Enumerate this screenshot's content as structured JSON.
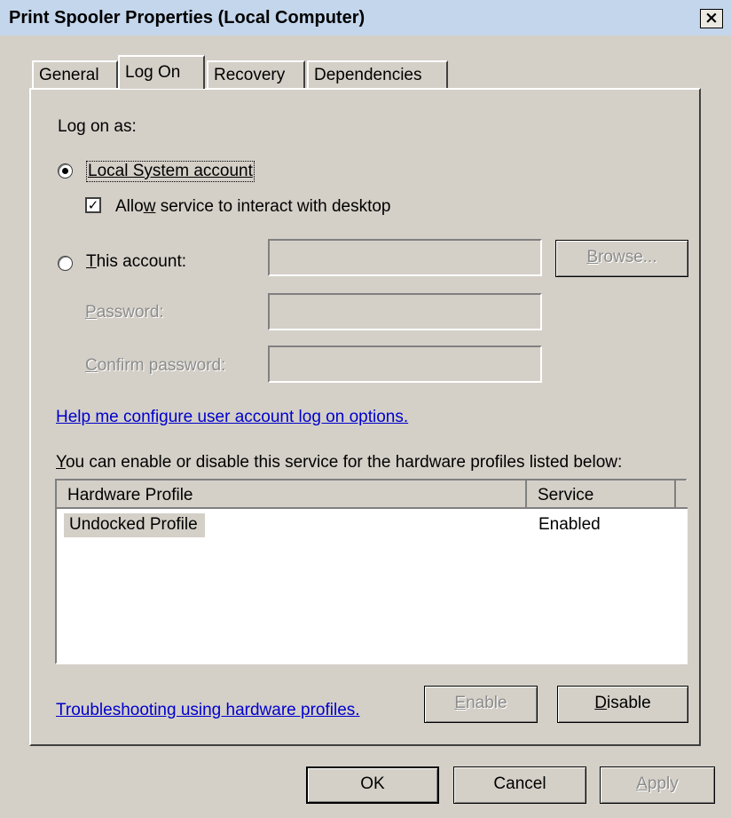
{
  "window": {
    "title": "Print Spooler Properties (Local Computer)",
    "close_glyph": "×"
  },
  "tabs": [
    {
      "label": "General",
      "active": false
    },
    {
      "label": "Log On",
      "active": true
    },
    {
      "label": "Recovery",
      "active": false
    },
    {
      "label": "Dependencies",
      "active": false
    }
  ],
  "logon": {
    "section_label": "Log on as:",
    "local_system": {
      "label": "Local System account",
      "selected": true
    },
    "allow_interact": {
      "label_pre": "Allo",
      "label_key": "w",
      "label_post": " service to interact with desktop",
      "checked": true
    },
    "this_account": {
      "label_key": "T",
      "label_rest": "his account:",
      "selected": false,
      "value": ""
    },
    "browse_label_key": "B",
    "browse_label_rest": "rowse...",
    "password": {
      "label_key": "P",
      "label_rest": "assword:",
      "value": ""
    },
    "confirm_password": {
      "label_key": "C",
      "label_rest": "onfirm password:",
      "value": ""
    },
    "help_link": "Help me configure user account log on options."
  },
  "hardware": {
    "intro_key": "Y",
    "intro_rest": "ou can enable or disable this service for the hardware profiles listed below:",
    "columns": [
      "Hardware Profile",
      "Service"
    ],
    "rows": [
      {
        "profile": "Undocked Profile",
        "service": "Enabled"
      }
    ],
    "troubleshoot_link": "Troubleshooting using hardware profiles.",
    "enable_key": "E",
    "enable_rest": "nable",
    "disable_key": "D",
    "disable_rest": "isable"
  },
  "footer": {
    "ok": "OK",
    "cancel": "Cancel",
    "apply_key": "A",
    "apply_rest": "pply"
  },
  "colors": {
    "titlebar": "#c4d6ec",
    "face": "#d4d0c8",
    "link": "#0000cc",
    "disabled_text": "#8c8c8c",
    "selection": "#d4d0c8"
  },
  "icons": {
    "close": "close-icon",
    "checkmark": "checkmark-icon"
  }
}
